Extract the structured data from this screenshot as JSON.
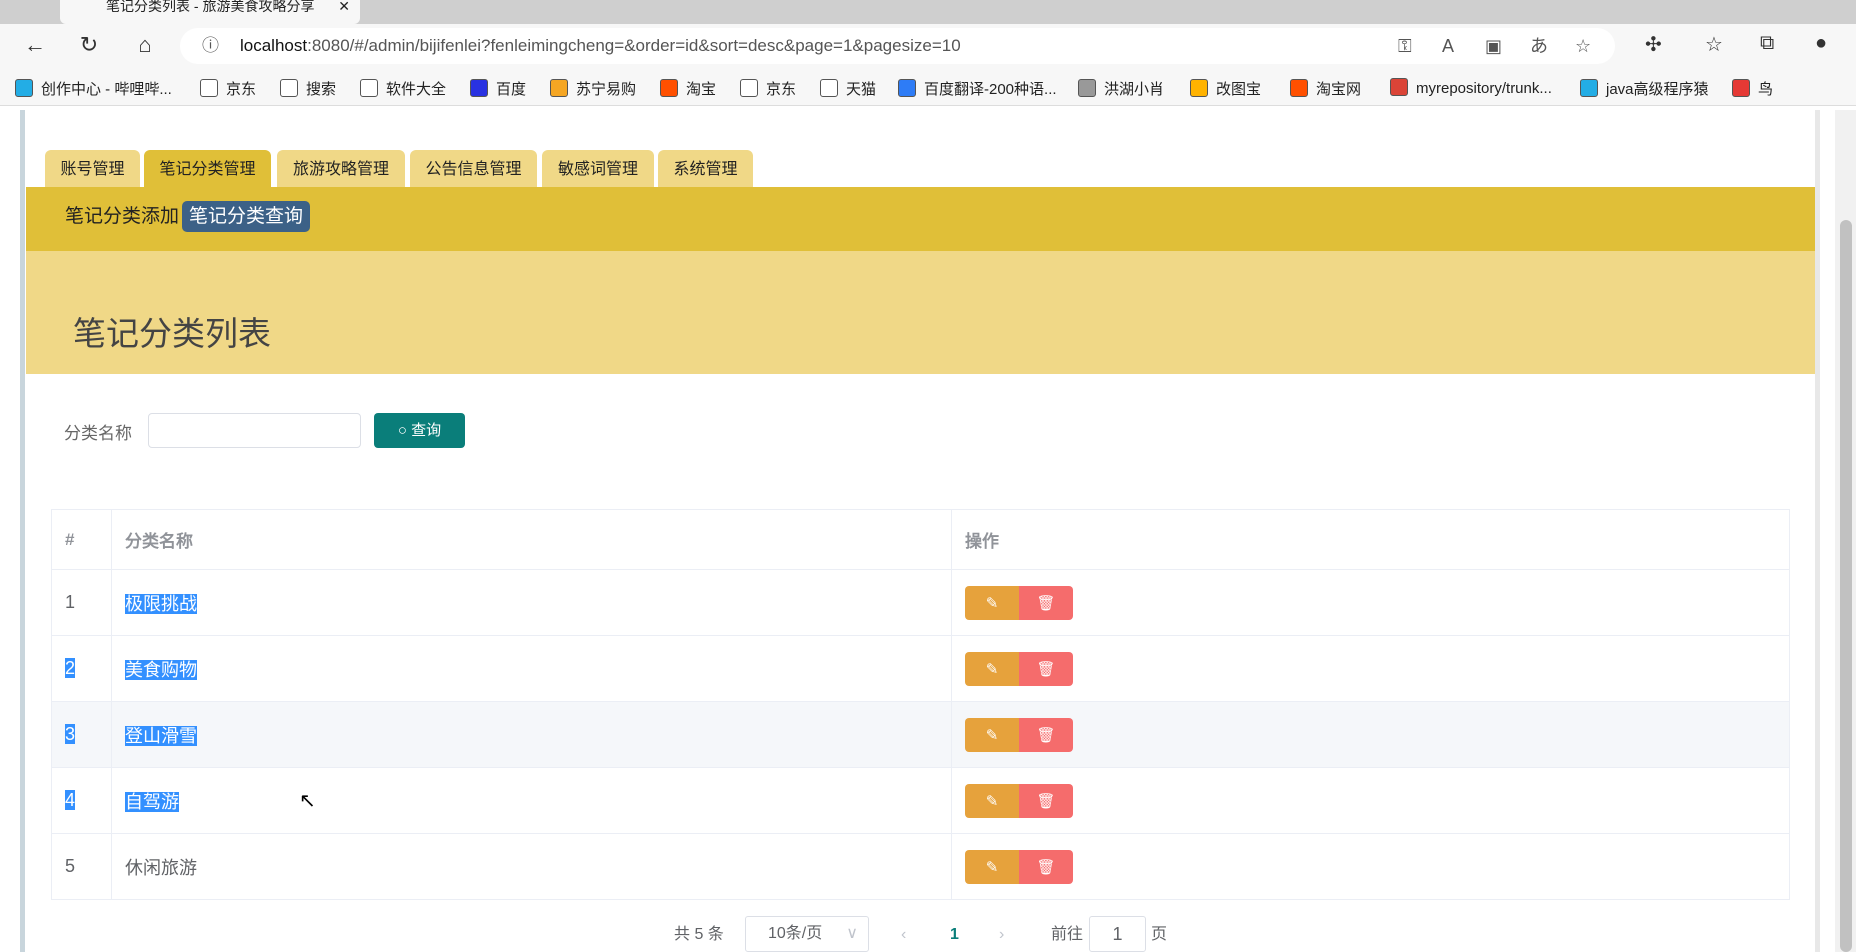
{
  "browser": {
    "tab_title": "笔记分类列表 - 旅游美食攻略分享",
    "url_host": "localhost",
    "url_rest": ":8080/#/admin/bijifenlei?fenleimingcheng=&order=id&sort=desc&page=1&pagesize=10",
    "bookmarks": [
      {
        "label": "创作中心 - 哔哩哔...",
        "color": "#23ade5"
      },
      {
        "label": "京东",
        "color": "#fff"
      },
      {
        "label": "搜索",
        "color": "#fff"
      },
      {
        "label": "软件大全",
        "color": "#fff"
      },
      {
        "label": "百度",
        "color": "#2932e1"
      },
      {
        "label": "苏宁易购",
        "color": "#f5a623"
      },
      {
        "label": "淘宝",
        "color": "#ff5000"
      },
      {
        "label": "京东",
        "color": "#fff"
      },
      {
        "label": "天猫",
        "color": "#fff"
      },
      {
        "label": "百度翻译-200种语...",
        "color": "#2e7cf6"
      },
      {
        "label": "洪湖小肖",
        "color": "#999"
      },
      {
        "label": "改图宝",
        "color": "#ffb300"
      },
      {
        "label": "淘宝网",
        "color": "#ff5000"
      },
      {
        "label": "myrepository/trunk...",
        "color": "#db4437"
      },
      {
        "label": "java高级程序猿",
        "color": "#23ade5"
      },
      {
        "label": "鸟",
        "color": "#e53935"
      }
    ]
  },
  "nav": {
    "tabs": [
      "账号管理",
      "笔记分类管理",
      "旅游攻略管理",
      "公告信息管理",
      "敏感词管理",
      "系统管理"
    ],
    "active": 1
  },
  "subnav": {
    "add": "笔记分类添加",
    "query": "笔记分类查询"
  },
  "page": {
    "title": "笔记分类列表"
  },
  "search": {
    "label": "分类名称",
    "value": "",
    "button": "查询"
  },
  "table": {
    "headers": [
      "#",
      "分类名称",
      "操作"
    ],
    "rows": [
      {
        "id": "1",
        "name": "极限挑战"
      },
      {
        "id": "2",
        "name": "美食购物"
      },
      {
        "id": "3",
        "name": "登山滑雪"
      },
      {
        "id": "4",
        "name": "自驾游"
      },
      {
        "id": "5",
        "name": "休闲旅游"
      }
    ]
  },
  "pagination": {
    "total": "共 5 条",
    "page_size": "10条/页",
    "current": "1",
    "goto_label": "前往",
    "goto_value": "1",
    "page_suffix": "页"
  },
  "colors": {
    "accent": "#e0bf38",
    "light": "#f0d887",
    "primary": "#0a7e7a",
    "edit": "#e6a23c",
    "delete": "#f56c6c",
    "active_sub": "#3c6187"
  }
}
